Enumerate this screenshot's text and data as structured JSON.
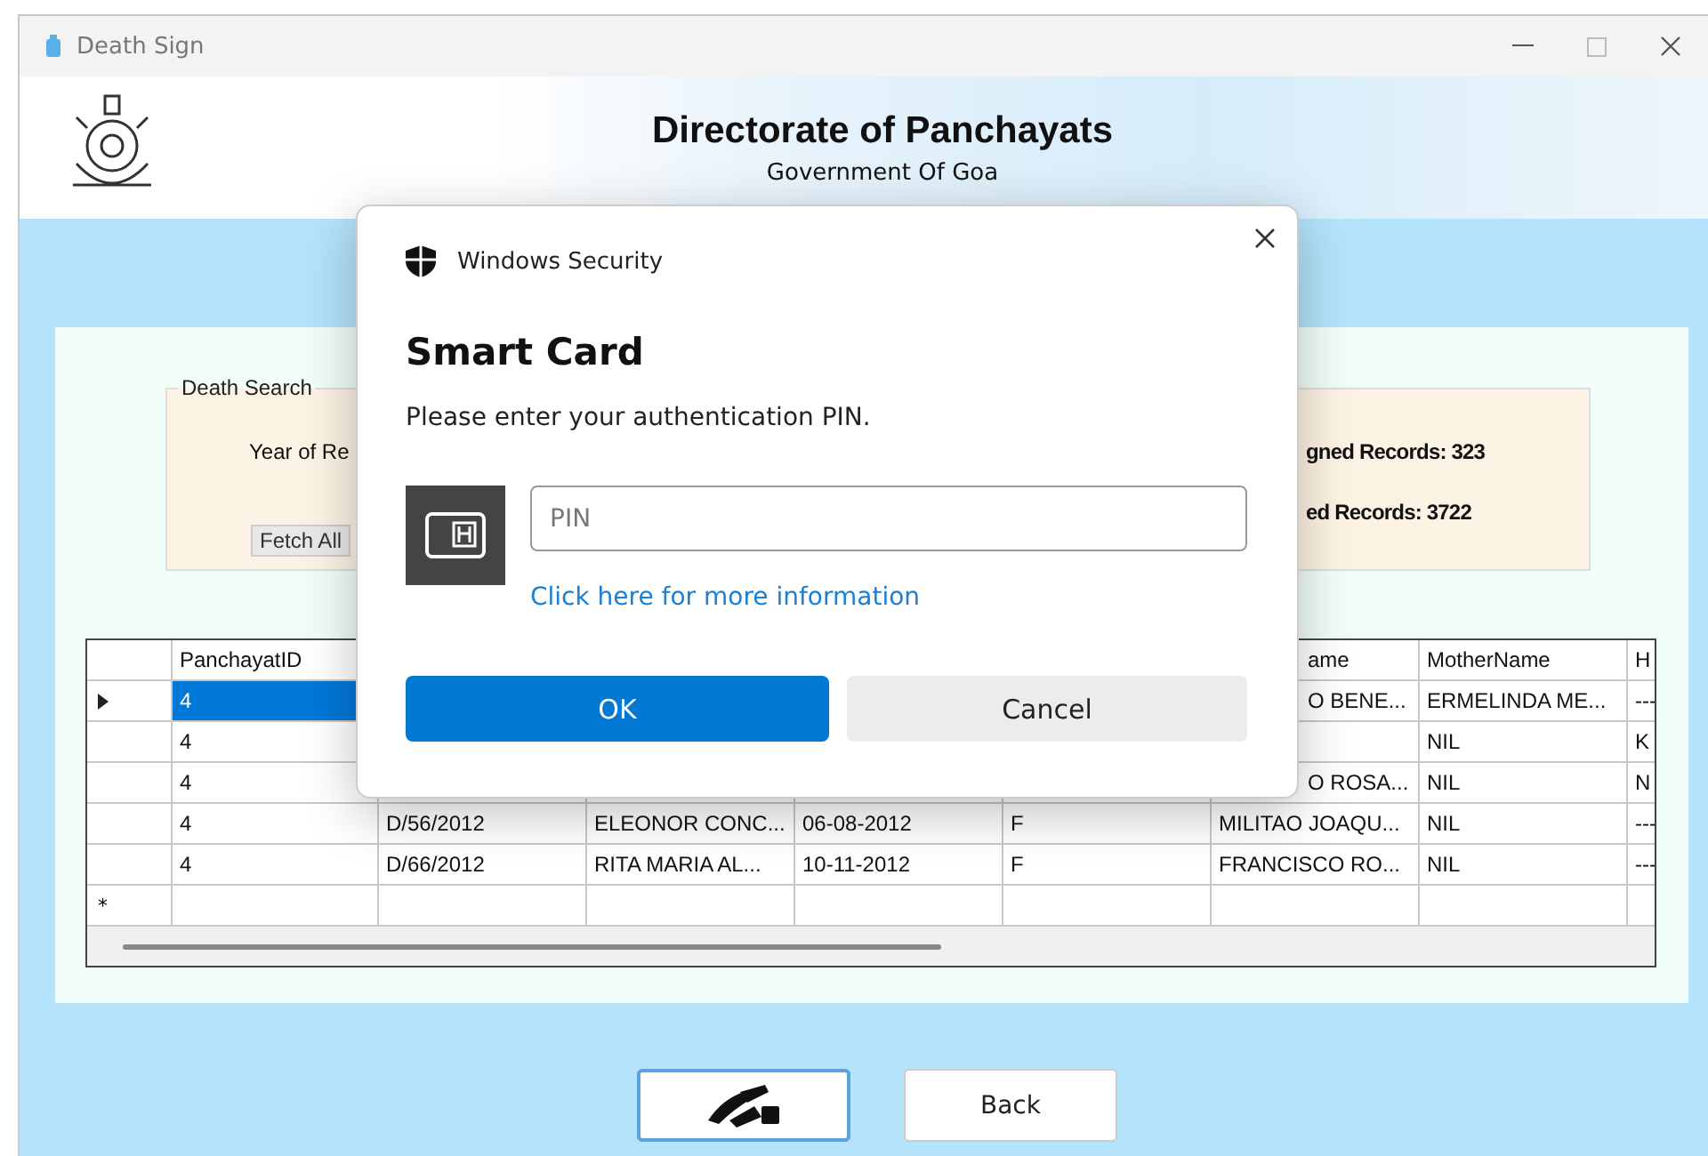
{
  "window": {
    "title": "Death Sign"
  },
  "banner": {
    "title": "Directorate of Panchayats",
    "subtitle": "Government Of Goa"
  },
  "search_group": {
    "title": "Death Search",
    "year_label": "Year of Re",
    "fetch_button": "Fetch All",
    "signed_records": "gned Records: 323",
    "unsigned_records": "ed Records: 3722"
  },
  "table": {
    "columns": [
      {
        "text": "PanchayatID",
        "cut": false
      },
      null,
      null,
      null,
      null,
      {
        "text": "ame",
        "cut": true
      },
      {
        "text": "MotherName",
        "cut": false
      },
      {
        "text": "H",
        "cut": false
      }
    ],
    "rows": [
      {
        "current": true,
        "selected": true,
        "cells": [
          {
            "text": "4",
            "cut": false
          },
          null,
          null,
          null,
          null,
          {
            "text": "O BENE...",
            "cut": true
          },
          {
            "text": "ERMELINDA ME...",
            "cut": false
          },
          {
            "text": "---",
            "cut": false
          }
        ]
      },
      {
        "current": false,
        "selected": false,
        "cells": [
          {
            "text": "4",
            "cut": false
          },
          null,
          null,
          null,
          null,
          null,
          {
            "text": "NIL",
            "cut": false
          },
          {
            "text": "K",
            "cut": false
          }
        ]
      },
      {
        "current": false,
        "selected": false,
        "cells": [
          {
            "text": "4",
            "cut": false
          },
          null,
          null,
          null,
          null,
          {
            "text": "O ROSA...",
            "cut": true
          },
          {
            "text": "NIL",
            "cut": false
          },
          {
            "text": "N",
            "cut": false
          }
        ]
      },
      {
        "current": false,
        "selected": false,
        "cells": [
          {
            "text": "4",
            "cut": false
          },
          {
            "text": "D/56/2012",
            "cut": false
          },
          {
            "text": "ELEONOR CONC...",
            "cut": false
          },
          {
            "text": "06-08-2012",
            "cut": false
          },
          {
            "text": "F",
            "cut": false
          },
          {
            "text": "MILITAO JOAQU...",
            "cut": false
          },
          {
            "text": "NIL",
            "cut": false
          },
          {
            "text": "---",
            "cut": false
          }
        ]
      },
      {
        "current": false,
        "selected": false,
        "cells": [
          {
            "text": "4",
            "cut": false
          },
          {
            "text": "D/66/2012",
            "cut": false
          },
          {
            "text": "RITA MARIA AL...",
            "cut": false
          },
          {
            "text": "10-11-2012",
            "cut": false
          },
          {
            "text": "F",
            "cut": false
          },
          {
            "text": "FRANCISCO RO...",
            "cut": false
          },
          {
            "text": "NIL",
            "cut": false
          },
          {
            "text": "---",
            "cut": false
          }
        ]
      }
    ],
    "new_row_marker": "*"
  },
  "actions": {
    "back_button": "Back"
  },
  "dialog": {
    "app_name": "Windows Security",
    "title": "Smart Card",
    "message": "Please enter your authentication PIN.",
    "pin_placeholder": "PIN",
    "link": "Click here for more information",
    "ok_button": "OK",
    "cancel_button": "Cancel"
  }
}
